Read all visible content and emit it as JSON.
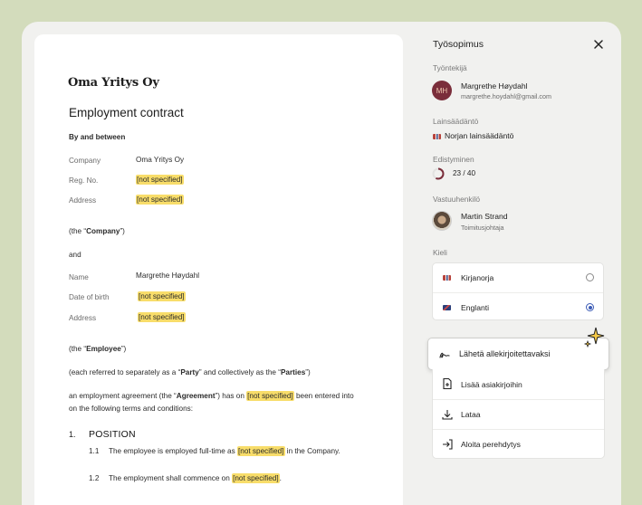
{
  "document": {
    "company_logo": "Oma Yritys Oy",
    "title": "Employment contract",
    "by_and_between": "By and between",
    "company_fields": [
      {
        "label": "Company",
        "value": "Oma Yritys Oy",
        "highlight": false
      },
      {
        "label": "Reg. No.",
        "value": "[not specified]",
        "highlight": true
      },
      {
        "label": "Address",
        "value": "[not specified]",
        "highlight": true
      }
    ],
    "company_alias_prefix": "(the “",
    "company_alias": "Company",
    "company_alias_suffix": "”)",
    "and": "and",
    "employee_fields": [
      {
        "label": "Name",
        "value": "Margrethe Høydahl",
        "highlight": false
      },
      {
        "label": "Date of birth",
        "value": "[not specified]",
        "highlight": true
      },
      {
        "label": "Address",
        "value": "[not specified]",
        "highlight": true
      }
    ],
    "employee_alias_prefix": "(the “",
    "employee_alias": "Employee",
    "employee_alias_suffix": "”)",
    "parties_p1": "(each referred to separately as a “",
    "party": "Party",
    "parties_p2": "” and collectively as the “",
    "parties": "Parties",
    "parties_p3": "”)",
    "agreement_p1": "an employment agreement (the “",
    "agreement": "Agreement",
    "agreement_p2": "”) has on ",
    "agreement_placeholder": "[not specified]",
    "agreement_p3": " been entered into",
    "agreement_line2": "on the following terms and conditions:",
    "section_number": "1.",
    "section_title": "POSITION",
    "clauses": [
      {
        "num": "1.1",
        "pre": "The employee is employed full-time as ",
        "placeholder": "[not specified]",
        "post": " in the Company."
      },
      {
        "num": "1.2",
        "pre": "The employment shall commence on ",
        "placeholder": "[not specified]",
        "post": "."
      }
    ]
  },
  "sidebar": {
    "title": "Työsopimus",
    "close_icon": "close-icon",
    "employee_label": "Työntekijä",
    "employee": {
      "initials": "MH",
      "name": "Margrethe Høydahl",
      "email": "margrethe.hoydahl@gmail.com"
    },
    "law_label": "Lainsäädäntö",
    "law_value": "Norjan lainsäädäntö",
    "progress_label": "Edistyminen",
    "progress": {
      "done": 23,
      "total": 40,
      "text": "23 / 40"
    },
    "responsible_label": "Vastuuhenkilö",
    "responsible": {
      "name": "Martin Strand",
      "role": "Toimitusjohtaja"
    },
    "language_label": "Kieli",
    "languages": [
      {
        "label": "Kirjanorja",
        "selected": false
      },
      {
        "label": "Englanti",
        "selected": true
      }
    ],
    "send_button": "Lähetä allekirjoitettavaksi",
    "actions": [
      {
        "label": "Lisää asiakirjoihin",
        "icon": "add-document-icon"
      },
      {
        "label": "Lataa",
        "icon": "download-icon"
      },
      {
        "label": "Aloita perehdytys",
        "icon": "sign-in-icon"
      }
    ]
  },
  "colors": {
    "background": "#d3dcbc",
    "highlight": "#f8dd6a",
    "avatar": "#7a2d3a",
    "radio_selected": "#3b5bb5"
  }
}
